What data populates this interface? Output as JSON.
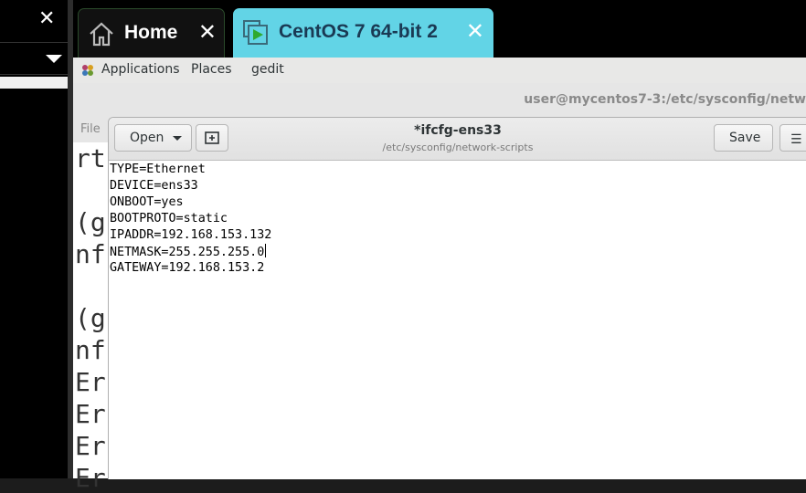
{
  "tabs": [
    {
      "label": "Home",
      "icon": "home-icon",
      "active": false
    },
    {
      "label": "CentOS 7 64-bit 2",
      "icon": "vm-play-icon",
      "active": true,
      "accent": "#62d4e6"
    }
  ],
  "gnome_bar": {
    "applications": "Applications",
    "places": "Places",
    "app": "gedit"
  },
  "terminal": {
    "title": "user@mycentos7-3:/etc/sysconfig/netw",
    "menu_file": "File",
    "lines": [
      "rt",
      "",
      "(g",
      "nf",
      "",
      "(g",
      "nf",
      "Er",
      "Er",
      "Er",
      "Er"
    ]
  },
  "gedit": {
    "open_label": "Open",
    "save_label": "Save",
    "title": "*ifcfg-ens33",
    "subtitle": "/etc/sysconfig/network-scripts",
    "lines": [
      "TYPE=Ethernet",
      "DEVICE=ens33",
      "ONBOOT=yes",
      "BOOTPROTO=static",
      "IPADDR=192.168.153.132",
      "NETMASK=255.255.255.0",
      "GATEWAY=192.168.153.2"
    ],
    "cursor_line": 5
  }
}
